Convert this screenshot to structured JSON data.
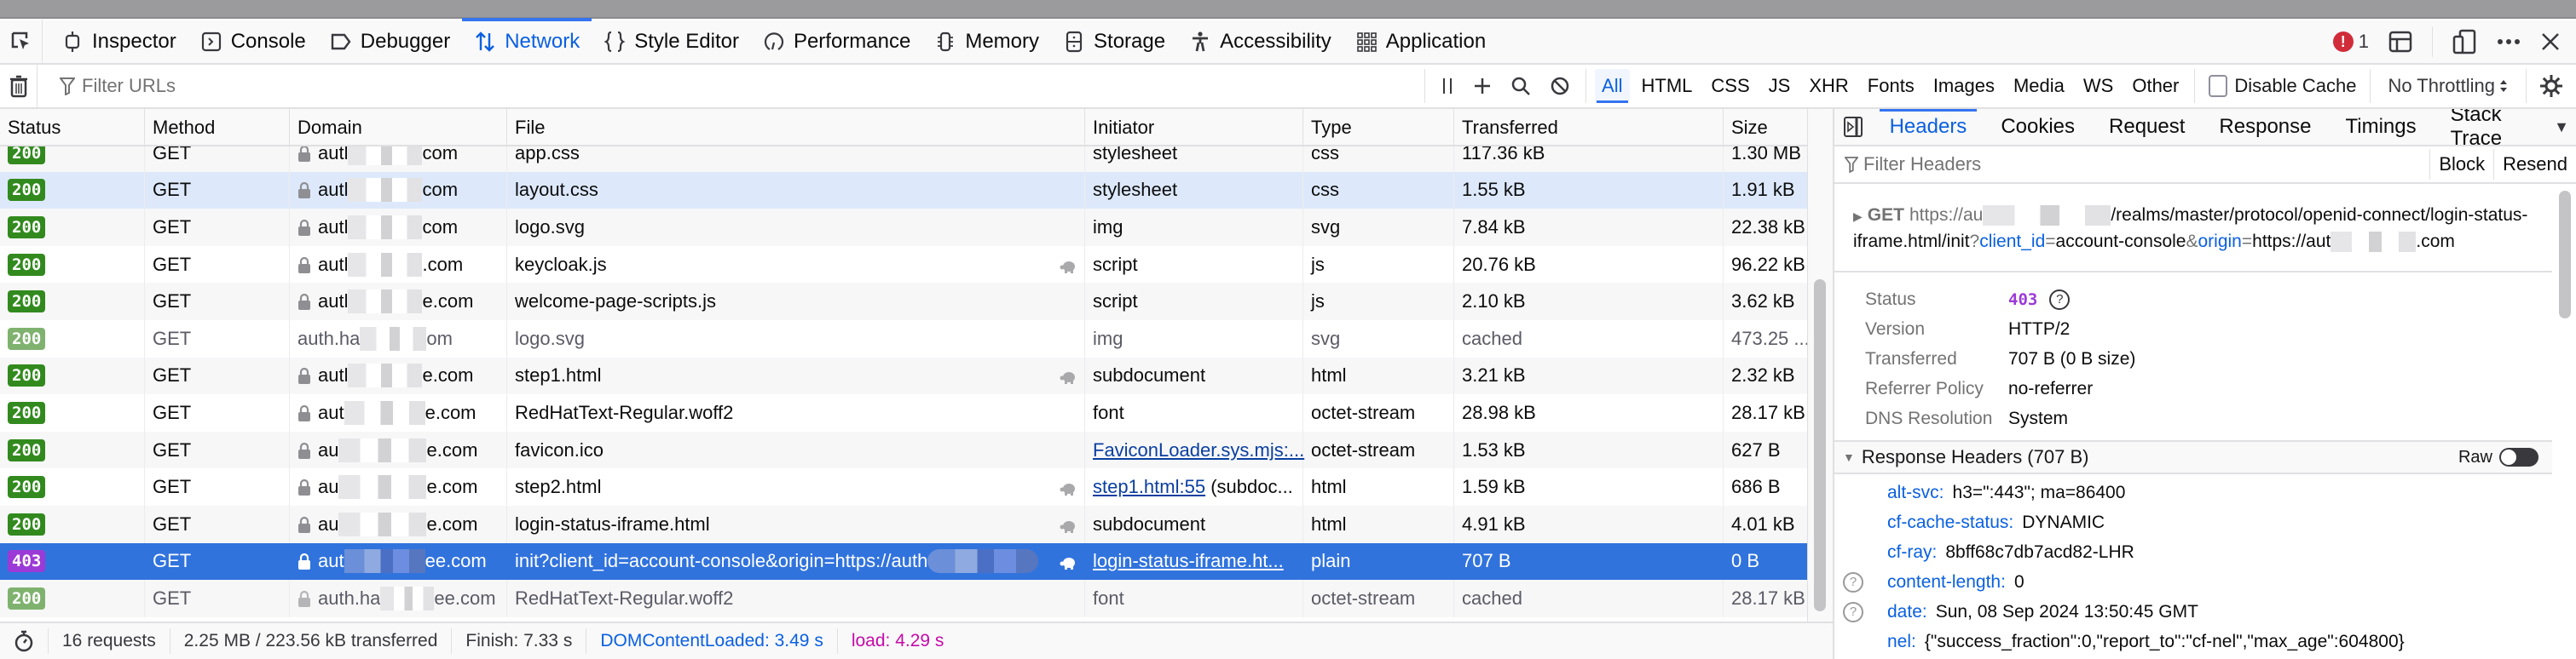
{
  "toolbox": {
    "tabs": [
      {
        "label": "Inspector",
        "icon": "inspector-icon"
      },
      {
        "label": "Console",
        "icon": "console-icon"
      },
      {
        "label": "Debugger",
        "icon": "debugger-icon"
      },
      {
        "label": "Network",
        "icon": "network-icon",
        "active": true
      },
      {
        "label": "Style Editor",
        "icon": "style-editor-icon"
      },
      {
        "label": "Performance",
        "icon": "performance-icon"
      },
      {
        "label": "Memory",
        "icon": "memory-icon"
      },
      {
        "label": "Storage",
        "icon": "storage-icon"
      },
      {
        "label": "Accessibility",
        "icon": "accessibility-icon"
      },
      {
        "label": "Application",
        "icon": "application-icon"
      }
    ],
    "error_count": "1"
  },
  "filterbar": {
    "filter_placeholder": "Filter URLs",
    "type_filters": [
      "All",
      "HTML",
      "CSS",
      "JS",
      "XHR",
      "Fonts",
      "Images",
      "Media",
      "WS",
      "Other"
    ],
    "active_type": "All",
    "disable_cache_label": "Disable Cache",
    "disable_cache_checked": false,
    "throttling": "No Throttling"
  },
  "table": {
    "columns": [
      "Status",
      "Method",
      "Domain",
      "File",
      "Initiator",
      "Type",
      "Transferred",
      "Size"
    ],
    "rows": [
      {
        "status": "200",
        "method": "GET",
        "domain_prefix": "autl",
        "domain_suffix": "com",
        "secure": true,
        "file": "app.css",
        "initiator": "stylesheet",
        "type": "css",
        "transferred": "117.36 kB",
        "size": "1.30 MB"
      },
      {
        "status": "200",
        "method": "GET",
        "domain_prefix": "autl",
        "domain_suffix": "com",
        "secure": true,
        "file": "layout.css",
        "initiator": "stylesheet",
        "type": "css",
        "transferred": "1.55 kB",
        "size": "1.91 kB",
        "state": "hover"
      },
      {
        "status": "200",
        "method": "GET",
        "domain_prefix": "autl",
        "domain_suffix": "com",
        "secure": true,
        "file": "logo.svg",
        "initiator": "img",
        "type": "svg",
        "transferred": "7.84 kB",
        "size": "22.38 kB"
      },
      {
        "status": "200",
        "method": "GET",
        "domain_prefix": "autl",
        "domain_suffix": ".com",
        "secure": true,
        "file": "keycloak.js",
        "initiator": "script",
        "type": "js",
        "transferred": "20.76 kB",
        "size": "96.22 kB",
        "tracker": true
      },
      {
        "status": "200",
        "method": "GET",
        "domain_prefix": "autl",
        "domain_suffix": "e.com",
        "secure": true,
        "file": "welcome-page-scripts.js",
        "initiator": "script",
        "type": "js",
        "transferred": "2.10 kB",
        "size": "3.62 kB"
      },
      {
        "status": "200",
        "method": "GET",
        "domain_prefix": "auth.ha",
        "domain_suffix": "om",
        "secure": false,
        "file": "logo.svg",
        "initiator": "img",
        "type": "svg",
        "transferred": "cached",
        "size": "473.25 ...",
        "state": "cached"
      },
      {
        "status": "200",
        "method": "GET",
        "domain_prefix": "autl",
        "domain_suffix": "e.com",
        "secure": true,
        "file": "step1.html",
        "initiator": "subdocument",
        "type": "html",
        "transferred": "3.21 kB",
        "size": "2.32 kB",
        "tracker": true
      },
      {
        "status": "200",
        "method": "GET",
        "domain_prefix": "aut",
        "domain_suffix": "e.com",
        "secure": true,
        "file": "RedHatText-Regular.woff2",
        "initiator": "font",
        "type": "octet-stream",
        "transferred": "28.98 kB",
        "size": "28.17 kB"
      },
      {
        "status": "200",
        "method": "GET",
        "domain_prefix": "au",
        "domain_suffix": "e.com",
        "secure": true,
        "file": "favicon.ico",
        "initiator_link": "FaviconLoader.sys.mjs:...",
        "type": "octet-stream",
        "transferred": "1.53 kB",
        "size": "627 B"
      },
      {
        "status": "200",
        "method": "GET",
        "domain_prefix": "au",
        "domain_suffix": "e.com",
        "secure": true,
        "file": "step2.html",
        "initiator_link": "step1.html:55",
        "initiator": " (subdoc...",
        "type": "html",
        "transferred": "1.59 kB",
        "size": "686 B",
        "tracker": true
      },
      {
        "status": "200",
        "method": "GET",
        "domain_prefix": "au",
        "domain_suffix": "e.com",
        "secure": true,
        "file": "login-status-iframe.html",
        "initiator": "subdocument",
        "type": "html",
        "transferred": "4.91 kB",
        "size": "4.01 kB",
        "tracker": true
      },
      {
        "status": "403",
        "method": "GET",
        "domain_prefix": "aut",
        "domain_suffix": "ee.com",
        "secure": true,
        "file": "init?client_id=account-console&origin=https://auth",
        "initiator_link": "login-status-iframe.ht...",
        "type": "plain",
        "transferred": "707 B",
        "size": "0 B",
        "tracker": true,
        "state": "selected"
      },
      {
        "status": "200",
        "method": "GET",
        "domain_prefix": "auth.ha",
        "domain_suffix": "ee.com",
        "secure": true,
        "file": "RedHatText-Regular.woff2",
        "initiator": "font",
        "type": "octet-stream",
        "transferred": "cached",
        "size": "28.17 kB",
        "state": "cached"
      }
    ]
  },
  "footer": {
    "requests": "16 requests",
    "transferred": "2.25 MB / 223.56 kB transferred",
    "finish": "Finish: 7.33 s",
    "dom_content_loaded": "DOMContentLoaded: 3.49 s",
    "load": "load: 4.29 s"
  },
  "side_panel": {
    "tabs": [
      "Headers",
      "Cookies",
      "Request",
      "Response",
      "Timings",
      "Stack Trace"
    ],
    "active_tab": "Headers",
    "filter_placeholder": "Filter Headers",
    "block_label": "Block",
    "resend_label": "Resend",
    "request_url": {
      "method": "GET",
      "prefix": "https://au",
      "path": "/realms/master/protocol/openid-connect/login-status-iframe.html/init",
      "q": "?",
      "k1": "client_id",
      "eq1": "=",
      "v1": "account-console",
      "amp": "&",
      "k2": "origin",
      "eq2": "=",
      "v2a": "https://aut",
      "v2b": ".com"
    },
    "summary": [
      {
        "label": "Status",
        "value": "403",
        "kind": "status"
      },
      {
        "label": "Version",
        "value": "HTTP/2"
      },
      {
        "label": "Transferred",
        "value": "707 B (0 B size)"
      },
      {
        "label": "Referrer Policy",
        "value": "no-referrer"
      },
      {
        "label": "DNS Resolution",
        "value": "System"
      }
    ],
    "response_headers_title": "Response Headers (707 B)",
    "raw_label": "Raw",
    "raw_enabled": false,
    "response_headers": [
      {
        "name": "alt-svc:",
        "value": "h3=\":443\"; ma=86400",
        "help": false
      },
      {
        "name": "cf-cache-status:",
        "value": "DYNAMIC",
        "help": false
      },
      {
        "name": "cf-ray:",
        "value": "8bff68c7db7acd82-LHR",
        "help": false
      },
      {
        "name": "content-length:",
        "value": "0",
        "help": true
      },
      {
        "name": "date:",
        "value": "Sun, 08 Sep 2024 13:50:45 GMT",
        "help": true
      },
      {
        "name": "nel:",
        "value": "{\"success_fraction\":0,\"report_to\":\"cf-nel\",\"max_age\":604800}",
        "help": false
      }
    ]
  }
}
